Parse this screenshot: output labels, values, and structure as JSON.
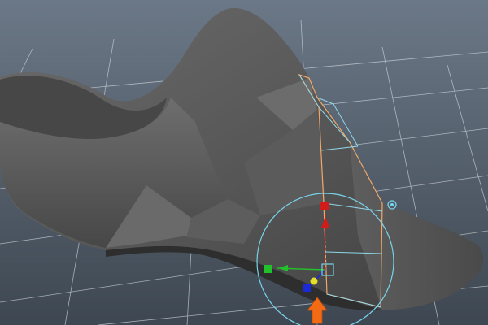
{
  "viewport": {
    "background_top": "#6b7887",
    "background_bottom": "#3e4751",
    "grid_color": "#c9d1d8",
    "mesh_dark": "#3b3b3b",
    "mesh_mid": "#5a5a5a",
    "mesh_light": "#7a7a7a",
    "wireframe_color": "#8fd7ea",
    "selection_color": "#f0a868"
  },
  "manipulator": {
    "type": "move-rotate-manipulator",
    "x_axis_color": "#22c02a",
    "y_axis_color": "#d11c1c",
    "z_axis_color": "#1a2bd6",
    "center_color": "#e4e02a",
    "ring_color": "#77d3ea",
    "pivot_color": "#77d3ea"
  },
  "annotation": {
    "icon": "orange-arrow-icon",
    "color": "#f26b14"
  }
}
